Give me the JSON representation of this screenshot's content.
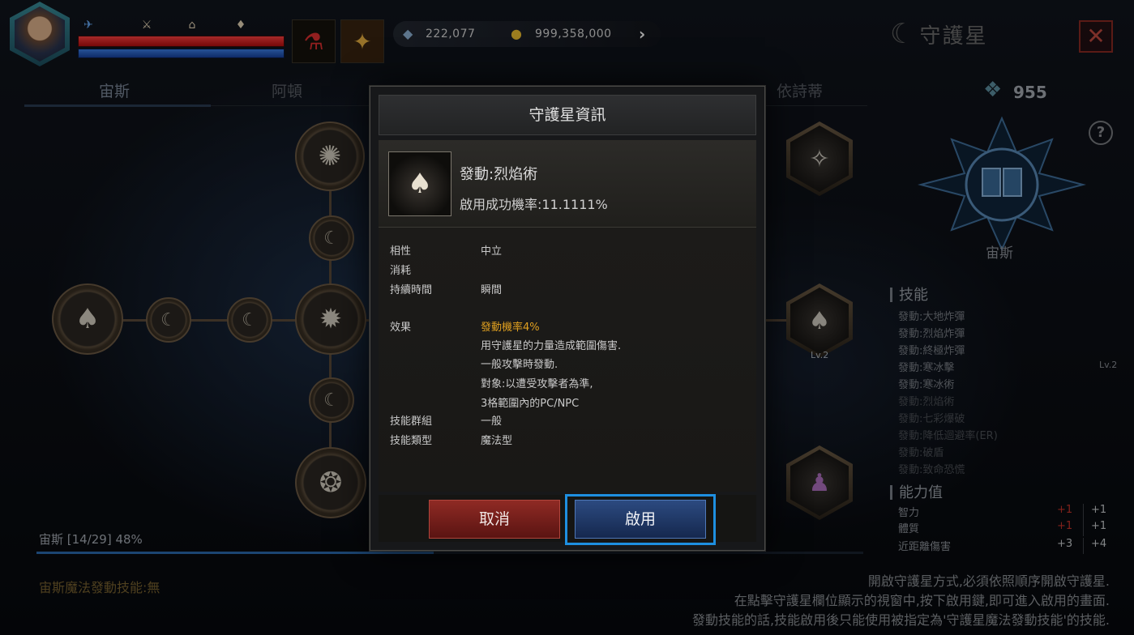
{
  "hud": {
    "currency1_value": "222,077",
    "currency2_value": "999,358,000",
    "currency1_icon": "crystal-icon",
    "currency2_icon": "gold-coin-icon"
  },
  "header": {
    "title": "守護星"
  },
  "tabs": [
    {
      "label": "宙斯"
    },
    {
      "label": "阿頓"
    },
    {
      "label": "依詩蒂"
    }
  ],
  "progress": {
    "label": "宙斯 [14/29] 48%",
    "percent": 48
  },
  "magic_skill_label": "宙斯魔法發動技能:無",
  "help_text": [
    "開啟守護星方式,必須依照順序開啟守護星.",
    "在點擊守護星欄位顯示的視窗中,按下啟用鍵,即可進入啟用的畫面.",
    "發動技能的話,技能啟用後只能使用被指定為'守護星魔法發動技能'的技能."
  ],
  "node_levels": {
    "hex_middle": "Lv.2"
  },
  "right_panel": {
    "gem_count": "955",
    "emblem_name": "宙斯",
    "skills_header": "技能",
    "skills": [
      {
        "name": "發動:大地炸彈",
        "active": true
      },
      {
        "name": "發動:烈焰炸彈",
        "active": true
      },
      {
        "name": "發動:終極炸彈",
        "active": true
      },
      {
        "name": "發動:寒冰擊",
        "active": true
      },
      {
        "name": "發動:寒冰術",
        "active": true
      },
      {
        "name": "發動:烈焰術",
        "active": false
      },
      {
        "name": "發動:七彩爆破",
        "active": false
      },
      {
        "name": "發動:降低迴避率(ER)",
        "active": false
      },
      {
        "name": "發動:破盾",
        "active": false
      },
      {
        "name": "發動:致命恐慌",
        "active": false
      }
    ],
    "skill_level": "Lv.2",
    "stats_header": "能力值",
    "stats": [
      {
        "name": "智力",
        "next": "+1",
        "total": "+1"
      },
      {
        "name": "體質",
        "next": "+1",
        "total": "+1"
      },
      {
        "name": "近距離傷害",
        "next": "+3",
        "total": "+4"
      }
    ]
  },
  "modal": {
    "title": "守護星資訊",
    "skill_name": "發動:烈焰術",
    "skill_rate": "啟用成功機率:11.1111%",
    "rows": {
      "attribute_label": "相性",
      "attribute_value": "中立",
      "cost_label": "消耗",
      "duration_label": "持續時間",
      "duration_value": "瞬間",
      "effect_label": "效果",
      "effect_highlight": "發動機率4%",
      "effect_line1": "用守護星的力量造成範圍傷害.",
      "effect_line2": "一般攻擊時發動.",
      "effect_line3": "對象:以遭受攻擊者為準,",
      "effect_line4": "3格範圍內的PC/NPC",
      "group_label": "技能群組",
      "group_value": "一般",
      "type_label": "技能類型",
      "type_value": "魔法型"
    },
    "cancel_label": "取消",
    "enable_label": "啟用"
  }
}
